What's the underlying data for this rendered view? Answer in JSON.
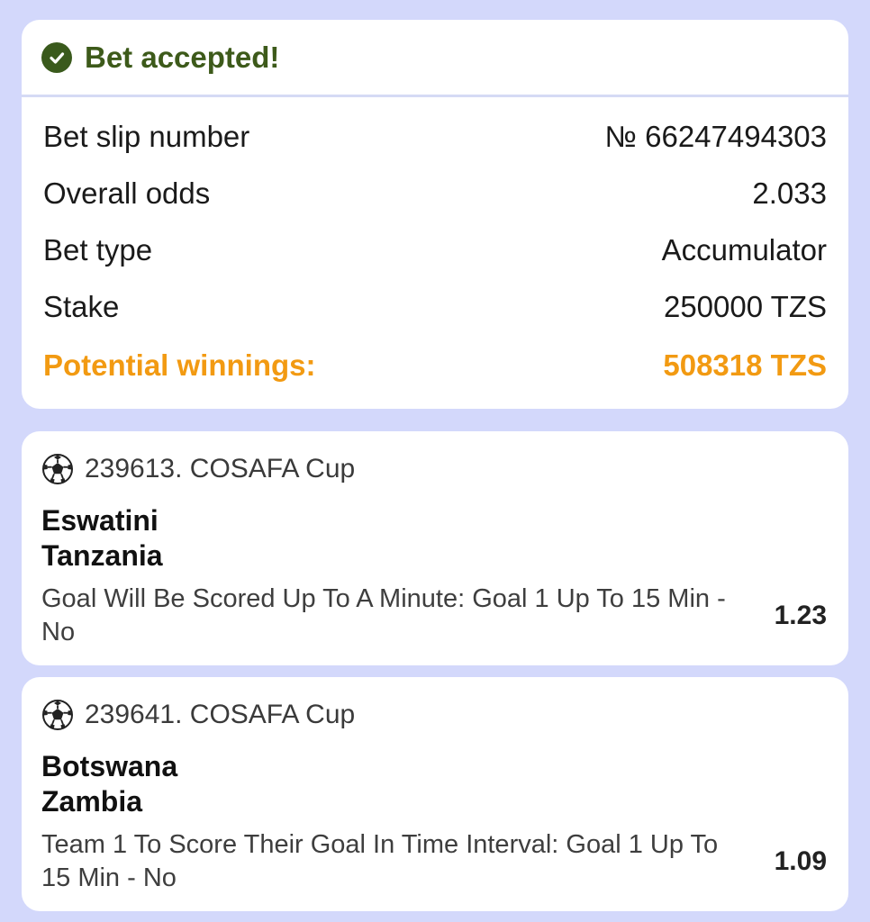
{
  "header": {
    "title": "Bet accepted!"
  },
  "summary": {
    "rows": [
      {
        "label": "Bet slip number",
        "value": "№ 66247494303"
      },
      {
        "label": "Overall odds",
        "value": "2.033"
      },
      {
        "label": "Bet type",
        "value": "Accumulator"
      },
      {
        "label": "Stake",
        "value": "250000 TZS"
      }
    ],
    "potential": {
      "label": "Potential winnings:",
      "value": "508318 TZS"
    }
  },
  "bets": [
    {
      "league": "239613. COSAFA Cup",
      "team1": "Eswatini",
      "team2": "Tanzania",
      "selection": "Goal Will Be Scored Up To A Minute: Goal 1 Up To 15 Min - No",
      "odds": "1.23"
    },
    {
      "league": "239641. COSAFA Cup",
      "team1": "Botswana",
      "team2": "Zambia",
      "selection": "Team 1 To Score Their Goal In Time Interval: Goal 1 Up To 15 Min - No",
      "odds": "1.09"
    }
  ],
  "colors": {
    "background": "#d3d8fb",
    "success": "#3d5a1a",
    "highlight": "#f29a12"
  },
  "icons": {
    "header": "check-circle-icon",
    "sport": "soccer-ball-icon"
  }
}
